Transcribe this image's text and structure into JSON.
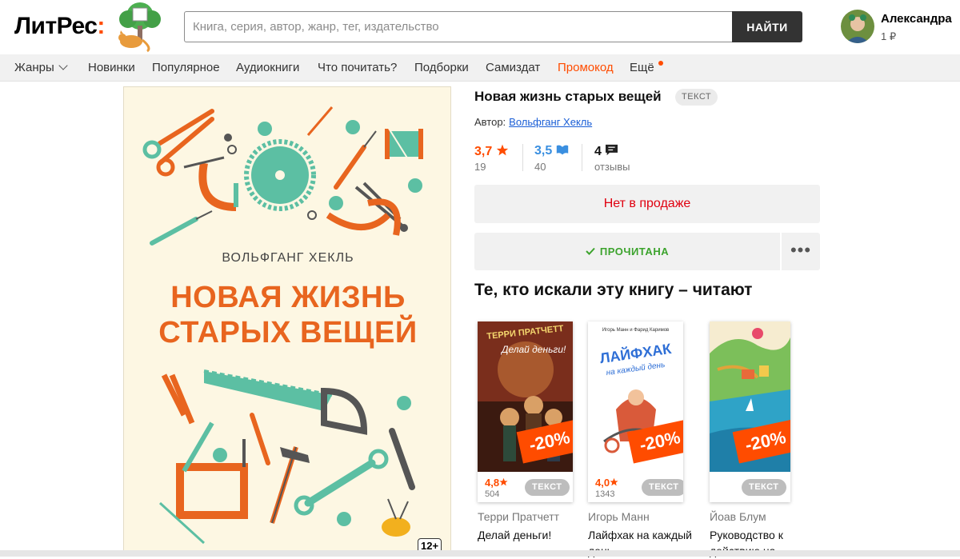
{
  "header": {
    "logo_main": "ЛитРес",
    "logo_colon": ":",
    "search_placeholder": "Книга, серия, автор, жанр, тег, издательство",
    "search_button": "НАЙТИ",
    "user_name": "Александра",
    "user_balance": "1 ₽"
  },
  "nav": {
    "items": [
      "Жанры",
      "Новинки",
      "Популярное",
      "Аудиокниги",
      "Что почитать?",
      "Подборки",
      "Самиздат",
      "Промокод",
      "Ещё"
    ]
  },
  "cover": {
    "author": "ВОЛЬФГАНГ ХЕКЛЬ",
    "title_line1": "НОВАЯ ЖИЗНЬ",
    "title_line2": "СТАРЫХ ВЕЩЕЙ",
    "age": "12+"
  },
  "book": {
    "title": "Новая жизнь старых вещей",
    "type": "ТЕКСТ",
    "author_label": "Автор:",
    "author_name": "Вольфганг Хекль",
    "rating_litres": "3,7",
    "rating_litres_count": "19",
    "rating_livelib": "3,5",
    "rating_livelib_count": "40",
    "reviews": "4",
    "reviews_label": "отзывы",
    "not_for_sale": "Нет в продаже",
    "read_label": "ПРОЧИТАНА",
    "more": "•••"
  },
  "recommend": {
    "heading": "Те, кто искали эту книгу – читают",
    "cards": [
      {
        "author": "Терри Пратчетт",
        "title": "Делай деньги!",
        "rating": "4,8",
        "count": "504",
        "type": "ТЕКСТ",
        "discount": "-20%",
        "cover_text": "ТЕРРИ ПРАТЧЕТТ",
        "cover_sub": "Делай деньги!"
      },
      {
        "author": "Игорь Манн",
        "title": "Лайфхак на каждый день",
        "rating": "4,0",
        "count": "1343",
        "type": "ТЕКСТ",
        "discount": "-20%",
        "cover_text": "ЛАЙФХАК",
        "cover_sub": "на каждый день",
        "cover_top": "Игорь Манн и Фарид Каримов"
      },
      {
        "author": "Йоав Блум",
        "title": "Руководство к действию на",
        "rating": "",
        "count": "",
        "type": "ТЕКСТ",
        "discount": "-20%"
      }
    ]
  },
  "colors": {
    "brand": "#ff4c00",
    "cover_orange": "#e8651f",
    "teal": "#5cbfa3",
    "link": "#1a5ed6",
    "livelib": "#3a8fe0"
  }
}
